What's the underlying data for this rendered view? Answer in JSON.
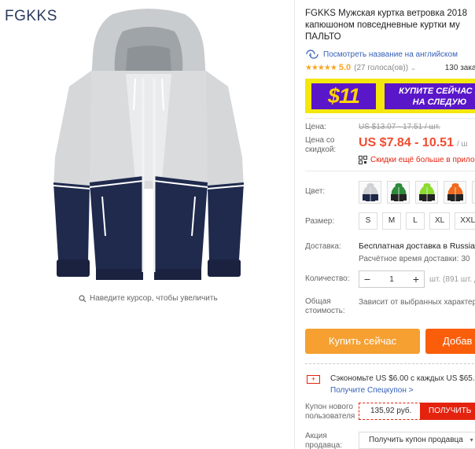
{
  "brand": "FGKKS",
  "zoom_hint": "Наведите курсор, чтобы увеличить",
  "product": {
    "title_lines": [
      "FGKKS Мужская куртка ветровка 2018",
      "капюшоном повседневные куртки му",
      "ПАЛЬТО"
    ],
    "translate_link": "Посмотреть название на английском",
    "stars": "★★★★★",
    "rating": "5.0",
    "votes": "(27 голоса(ов))",
    "orders": "130 заказ"
  },
  "banner": {
    "amount": "$11",
    "line1": "КУПИТЕ СЕЙЧАС Е",
    "line2": "НА СЛЕДУЮ"
  },
  "price": {
    "label": "Цена:",
    "old": "US $13.07 - 17.51 / шт.",
    "discount_label_1": "Цена со",
    "discount_label_2": "скидкой:",
    "new": "US $7.84 - 10.51",
    "unit": "/ ш",
    "app_discount": "Скидки ещё больше в прило"
  },
  "color": {
    "label": "Цвет:",
    "swatches": [
      {
        "icon": "jacket-gray-navy-icon",
        "top": "#cfd1d3",
        "bottom": "#1d2747"
      },
      {
        "icon": "jacket-green-black-icon",
        "top": "#2f8a3c",
        "bottom": "#222"
      },
      {
        "icon": "jacket-lime-black-icon",
        "top": "#8bdc2f",
        "bottom": "#222"
      },
      {
        "icon": "jacket-orange-black-icon",
        "top": "#f06a1e",
        "bottom": "#222"
      },
      {
        "icon": "jacket-blue-black-icon",
        "top": "#3a6fd1",
        "bottom": "#222"
      }
    ]
  },
  "size": {
    "label": "Размер:",
    "options": [
      "S",
      "M",
      "L",
      "XL",
      "XXL"
    ]
  },
  "shipping": {
    "label": "Доставка:",
    "value": "Бесплатная доставка в Russian",
    "estimate": "Расчётное время доставки: 30"
  },
  "quantity": {
    "label": "Количество:",
    "minus": "−",
    "value": "1",
    "plus": "+",
    "available": "шт. (891 шт. дост"
  },
  "total": {
    "label_1": "Общая",
    "label_2": "стоимость:",
    "value": "Зависит от выбранных характер"
  },
  "buttons": {
    "buy_now": "Купить сейчас",
    "add_to_cart": "Добав"
  },
  "coupon": {
    "save_text": "Сэкономьте US $6.00 с каждых US $65.0",
    "speccoupon_link": "Получите Спецкупон >",
    "new_user_label_1": "Купон нового",
    "new_user_label_2": "пользователя",
    "new_user_value": "135,92 руб.",
    "get_button": "ПОЛУЧИТЬ",
    "seller_label_1": "Акция",
    "seller_label_2": "продавца:",
    "seller_select": "Получить купон продавца"
  },
  "colors": {
    "accent_price": "#f24b2f",
    "buy_button": "#f5a031",
    "cart_button": "#fa5e0b",
    "link": "#3660b8",
    "banner_yellow": "#f4e70c",
    "banner_purple": "#5a17c9"
  }
}
